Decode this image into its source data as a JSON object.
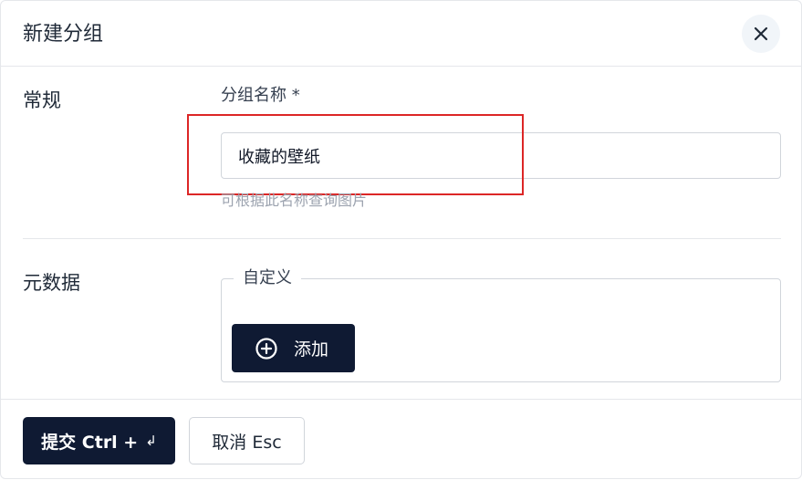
{
  "dialog": {
    "title": "新建分组",
    "close_icon": "close-icon"
  },
  "general": {
    "section_label": "常规",
    "field_label": "分组名称 *",
    "name_value": "收藏的壁纸",
    "hint": "可根据此名称查询图片"
  },
  "metadata": {
    "section_label": "元数据",
    "custom_legend": "自定义",
    "add_label": "添加",
    "add_icon": "plus-circle-icon"
  },
  "footer": {
    "submit_label": "提交 Ctrl +",
    "submit_shortcut_glyph": "↲",
    "cancel_label": "取消 Esc"
  },
  "colors": {
    "primary": "#0f1a33",
    "highlight": "#dc2626",
    "hint": "#9ca3af"
  }
}
